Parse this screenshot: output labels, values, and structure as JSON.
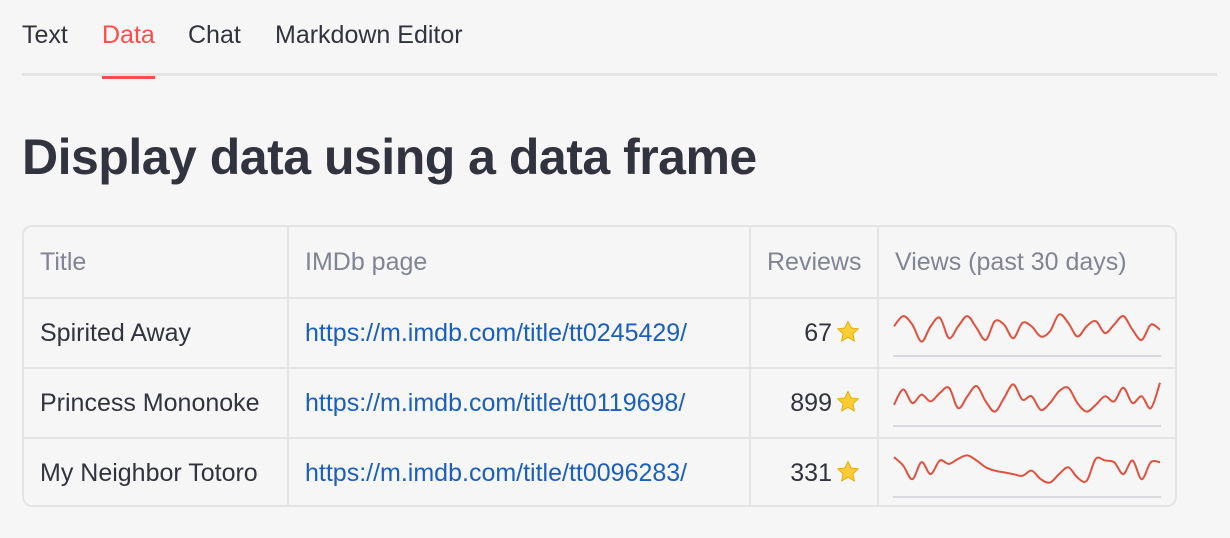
{
  "tabs": [
    {
      "label": "Text",
      "active": false
    },
    {
      "label": "Data",
      "active": true
    },
    {
      "label": "Chat",
      "active": false
    },
    {
      "label": "Markdown Editor",
      "active": false
    }
  ],
  "heading": "Display data using a data frame",
  "colors": {
    "accent": "#ff4b4b",
    "link": "#1b5fbe",
    "text": "#31333f",
    "header_text": "#808495",
    "border": "#e4e4e6",
    "sparkline": "#e0523f"
  },
  "table": {
    "columns": [
      "Title",
      "IMDb page",
      "Reviews",
      "Views (past 30 days)"
    ],
    "rows": [
      {
        "title": "Spirited Away",
        "imdb": "https://m.imdb.com/title/tt0245429/",
        "reviews": "67",
        "review_icon": "star-icon",
        "views": [
          0.55,
          0.85,
          0.6,
          0.1,
          0.55,
          0.8,
          0.2,
          0.55,
          0.85,
          0.5,
          0.15,
          0.7,
          0.6,
          0.2,
          0.65,
          0.55,
          0.25,
          0.4,
          0.9,
          0.65,
          0.25,
          0.55,
          0.7,
          0.35,
          0.6,
          0.85,
          0.45,
          0.15,
          0.6,
          0.45
        ]
      },
      {
        "title": "Princess Mononoke",
        "imdb": "https://m.imdb.com/title/tt0119698/",
        "reviews": "899",
        "review_icon": "star-icon",
        "views": [
          0.3,
          0.75,
          0.35,
          0.6,
          0.4,
          0.65,
          0.8,
          0.2,
          0.55,
          0.85,
          0.4,
          0.1,
          0.5,
          0.9,
          0.45,
          0.55,
          0.15,
          0.35,
          0.7,
          0.8,
          0.35,
          0.1,
          0.3,
          0.55,
          0.4,
          0.8,
          0.35,
          0.55,
          0.2,
          0.95
        ]
      },
      {
        "title": "My Neighbor Totoro",
        "imdb": "https://m.imdb.com/title/tt0096283/",
        "reviews": "331",
        "review_icon": "star-icon",
        "views": [
          0.85,
          0.6,
          0.2,
          0.7,
          0.35,
          0.75,
          0.65,
          0.8,
          0.9,
          0.75,
          0.55,
          0.45,
          0.4,
          0.35,
          0.3,
          0.45,
          0.2,
          0.1,
          0.35,
          0.55,
          0.25,
          0.15,
          0.8,
          0.75,
          0.7,
          0.35,
          0.75,
          0.2,
          0.7,
          0.7
        ]
      }
    ]
  }
}
